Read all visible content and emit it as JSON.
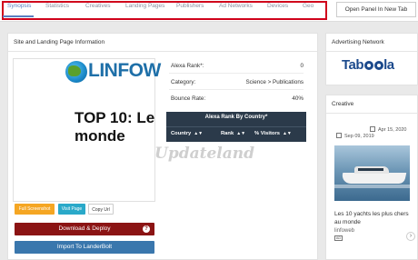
{
  "tabs": [
    {
      "label": "Synopsis",
      "active": true
    },
    {
      "label": "Statistics",
      "active": false
    },
    {
      "label": "Creatives",
      "active": false
    },
    {
      "label": "Landing Pages",
      "active": false
    },
    {
      "label": "Publishers",
      "active": false
    },
    {
      "label": "Ad Networks",
      "active": false
    },
    {
      "label": "Devices",
      "active": false
    },
    {
      "label": "Geo",
      "active": false
    }
  ],
  "open_panel_label": "Open Panel In New Tab",
  "site_panel": {
    "title": "Site and Landing Page Information",
    "preview": {
      "logo_text": "LINFOW",
      "headline": "TOP 10: Le\nmonde"
    },
    "info": [
      {
        "label": "Alexa Rank*:",
        "value": "0"
      },
      {
        "label": "Category:",
        "value": "Science > Publications"
      },
      {
        "label": "Bounce Rate:",
        "value": "40%"
      }
    ],
    "alexa_table": {
      "title": "Alexa Rank By Country*",
      "columns": [
        "Country",
        "Rank",
        "% Visitors"
      ]
    },
    "watermark": "Updateland",
    "buttons": {
      "full_screenshot": "Full Screenshot",
      "visit_page": "Visit Page",
      "copy_url": "Copy Url",
      "download": "Download & Deploy",
      "help": "?",
      "import": "Import To LanderBolt"
    }
  },
  "ad_network_panel": {
    "title": "Advertising Network",
    "network": "Taboola"
  },
  "creative_panel": {
    "title": "Creative",
    "last_seen": "Apr 15, 2020",
    "first_seen": "Sep 09, 2019",
    "card_title": "Les 10 yachts les plus chers au monde",
    "card_source": "linfoweb",
    "ad_badge": "AD",
    "next_arrow": "›"
  },
  "colors": {
    "accent": "#5a7fc0",
    "highlight_border": "#d0021b",
    "download_button": "#8b1414",
    "import_button": "#3a77ad",
    "full_screenshot": "#f5a623",
    "visit_page": "#2aa9c9",
    "table_header": "#2b3a4a",
    "taboola": "#1c4a8c"
  }
}
